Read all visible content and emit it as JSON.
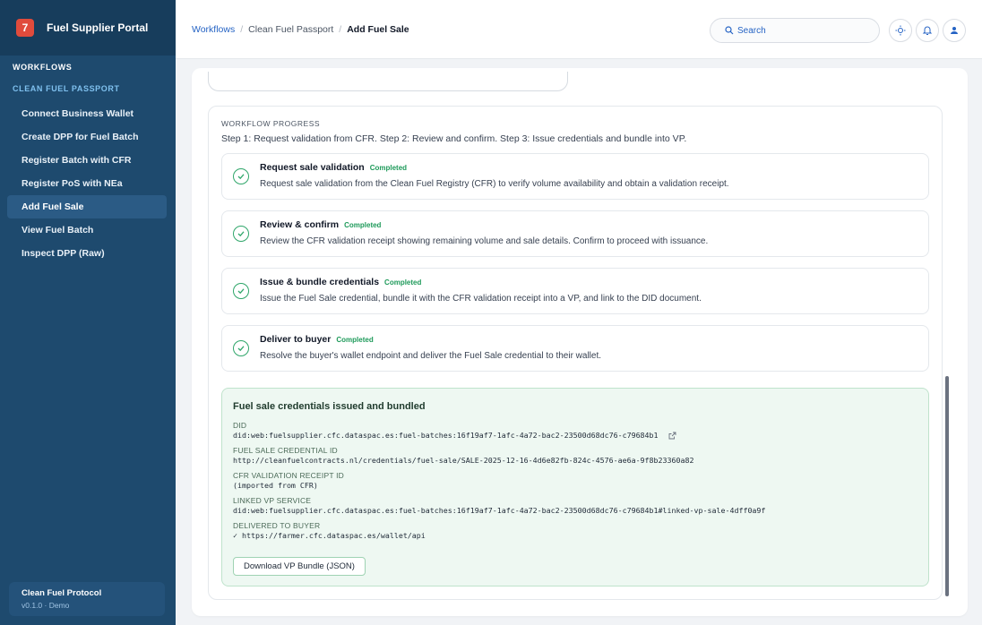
{
  "sidebar": {
    "brand_logo": "7",
    "brand_title": "Fuel Supplier Portal",
    "section_workflows": "WORKFLOWS",
    "section_clean_fuel": "CLEAN FUEL PASSPORT",
    "items": [
      {
        "label": "Connect Business Wallet"
      },
      {
        "label": "Create DPP for Fuel Batch"
      },
      {
        "label": "Register Batch with CFR"
      },
      {
        "label": "Register PoS with NEa"
      },
      {
        "label": "Add Fuel Sale"
      },
      {
        "label": "View Fuel Batch"
      },
      {
        "label": "Inspect DPP (Raw)"
      }
    ],
    "active_item": "Add Fuel Sale",
    "footer_title": "Clean Fuel Protocol",
    "footer_version": "v0.1.0 · Demo"
  },
  "header": {
    "breadcrumb": [
      "Workflows",
      "Clean Fuel Passport",
      "Add Fuel Sale"
    ],
    "breadcrumb_sep": "/",
    "search_placeholder": "Search",
    "icons": [
      "sun-icon",
      "bell-icon",
      "user-icon"
    ]
  },
  "workflow": {
    "heading": "WORKFLOW PROGRESS",
    "description": "Step 1: Request validation from CFR. Step 2: Review and confirm. Step 3: Issue credentials and bundle into VP.",
    "steps": [
      {
        "title": "Request sale validation",
        "status": "Completed",
        "description": "Request sale validation from the Clean Fuel Registry (CFR) to verify volume availability and obtain a validation receipt."
      },
      {
        "title": "Review & confirm",
        "status": "Completed",
        "description": "Review the CFR validation receipt showing remaining volume and sale details. Confirm to proceed with issuance."
      },
      {
        "title": "Issue & bundle credentials",
        "status": "Completed",
        "description": "Issue the Fuel Sale credential, bundle it with the CFR validation receipt into a VP, and link to the DID document."
      },
      {
        "title": "Deliver to buyer",
        "status": "Completed",
        "description": "Resolve the buyer's wallet endpoint and deliver the Fuel Sale credential to their wallet."
      }
    ]
  },
  "result": {
    "title": "Fuel sale credentials issued and bundled",
    "did_label": "DID",
    "did_value": "did:web:fuelsupplier.cfc.dataspac.es:fuel-batches:16f19af7-1afc-4a72-bac2-23500d68dc76-c79684b1",
    "credential_label": "FUEL SALE CREDENTIAL ID",
    "credential_value": "http://cleanfuelcontracts.nl/credentials/fuel-sale/SALE-2025-12-16-4d6e82fb-824c-4576-ae6a-9f8b23360a82",
    "receipt_label": "CFR VALIDATION RECEIPT ID",
    "receipt_value": "(imported from CFR)",
    "vp_label": "LINKED VP SERVICE",
    "vp_value": "did:web:fuelsupplier.cfc.dataspac.es:fuel-batches:16f19af7-1afc-4a72-bac2-23500d68dc76-c79684b1#linked-vp-sale-4dff0a9f",
    "delivered_label": "DELIVERED TO BUYER",
    "delivered_value": "✓ https://farmer.cfc.dataspac.es/wallet/api",
    "download_button": "Download VP Bundle (JSON)"
  },
  "colors": {
    "sidebar_bg": "#1e4a6e",
    "accent_blue": "#2563c4",
    "success_green": "#1e9a5a",
    "result_bg": "#eef8f2"
  }
}
